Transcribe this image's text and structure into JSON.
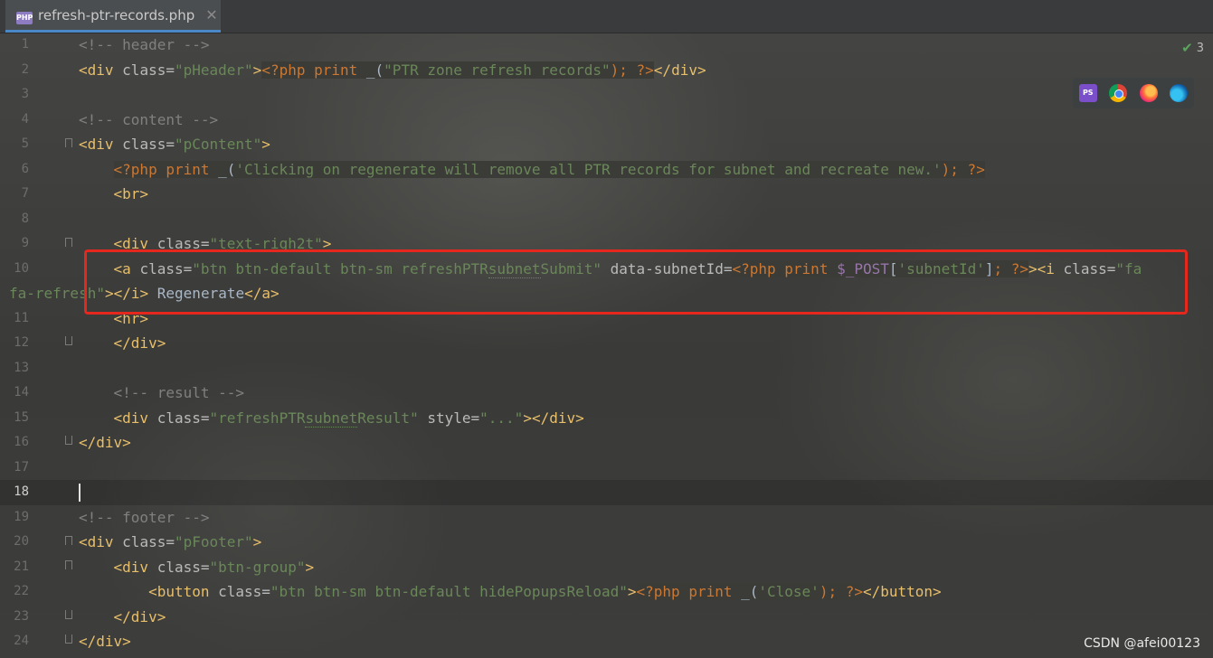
{
  "tab": {
    "icon_text": "PHP",
    "filename": "refresh-ptr-records.php",
    "close": "✕"
  },
  "inspection": {
    "count": "3"
  },
  "browser_icons": [
    "phpstorm-icon",
    "chrome-icon",
    "firefox-icon",
    "edge-icon"
  ],
  "ps_label": "PS",
  "line_numbers": [
    "1",
    "2",
    "3",
    "4",
    "5",
    "6",
    "7",
    "8",
    "9",
    "10",
    "11",
    "12",
    "13",
    "14",
    "15",
    "16",
    "17",
    "18",
    "19",
    "20",
    "21",
    "22",
    "23",
    "24"
  ],
  "current_line": "18",
  "code": {
    "l1": "<!-- header -->",
    "l2_open": "<div ",
    "l2_attr": "class=",
    "l2_val": "\"pHeader\"",
    "l2_gt": ">",
    "l2_php_open": "<?php ",
    "l2_kw": "print ",
    "l2_fn": "_(",
    "l2_str": "\"PTR zone refresh records\"",
    "l2_end": "); ?>",
    "l2_close": "</div>",
    "l4": "<!-- content -->",
    "l5_open": "<div ",
    "l5_attr": "class=",
    "l5_val": "\"pContent\"",
    "l5_gt": ">",
    "l6_php_open": "<?php ",
    "l6_kw": "print ",
    "l6_fn": "_(",
    "l6_str": "'Clicking on regenerate will remove all PTR records for subnet and recreate new.'",
    "l6_end": "); ?>",
    "l7": "<br>",
    "l9_open": "<div ",
    "l9_attr": "class=",
    "l9_val": "\"text-righ2t\"",
    "l9_gt": ">",
    "l10_open": "<a ",
    "l10_attr1": "class=",
    "l10_val1a": "\"btn btn-default btn-sm refreshPTR",
    "l10_val1u": "subnet",
    "l10_val1b": "Submit\"",
    "l10_attr2": " data-subnetId=",
    "l10_php_open": "<?php ",
    "l10_kw": "print ",
    "l10_var": "$_POST",
    "l10_br1": "[",
    "l10_key": "'subnetId'",
    "l10_br2": "]",
    "l10_end": "; ?>",
    "l10_i": "><i ",
    "l10_attr3": "class=",
    "l10_val3a": "\"fa",
    "l10b_val3b": "fa-refresh\"",
    "l10b_tags": "></i>",
    "l10b_text": " Regenerate",
    "l10b_close": "</a>",
    "l11": "<hr>",
    "l12": "</div>",
    "l14": "<!-- result -->",
    "l15_open": "<div ",
    "l15_attr1": "class=",
    "l15_val1a": "\"refreshPTR",
    "l15_val1u": "subnet",
    "l15_val1b": "Result\"",
    "l15_attr2": " style=",
    "l15_val2": "\"...\"",
    "l15_close": "></div>",
    "l16": "</div>",
    "l19": "<!-- footer -->",
    "l20_open": "<div ",
    "l20_attr": "class=",
    "l20_val": "\"pFooter\"",
    "l20_gt": ">",
    "l21_open": "<div ",
    "l21_attr": "class=",
    "l21_val": "\"btn-group\"",
    "l21_gt": ">",
    "l22_open": "<button ",
    "l22_attr": "class=",
    "l22_val": "\"btn btn-sm btn-default hidePopupsReload\"",
    "l22_gt": ">",
    "l22_php_open": "<?php ",
    "l22_kw": "print ",
    "l22_fn": "_(",
    "l22_str": "'Close'",
    "l22_end": "); ?>",
    "l22_close": "</button>",
    "l23": "</div>",
    "l24": "</div>"
  },
  "watermark": "CSDN @afei00123"
}
